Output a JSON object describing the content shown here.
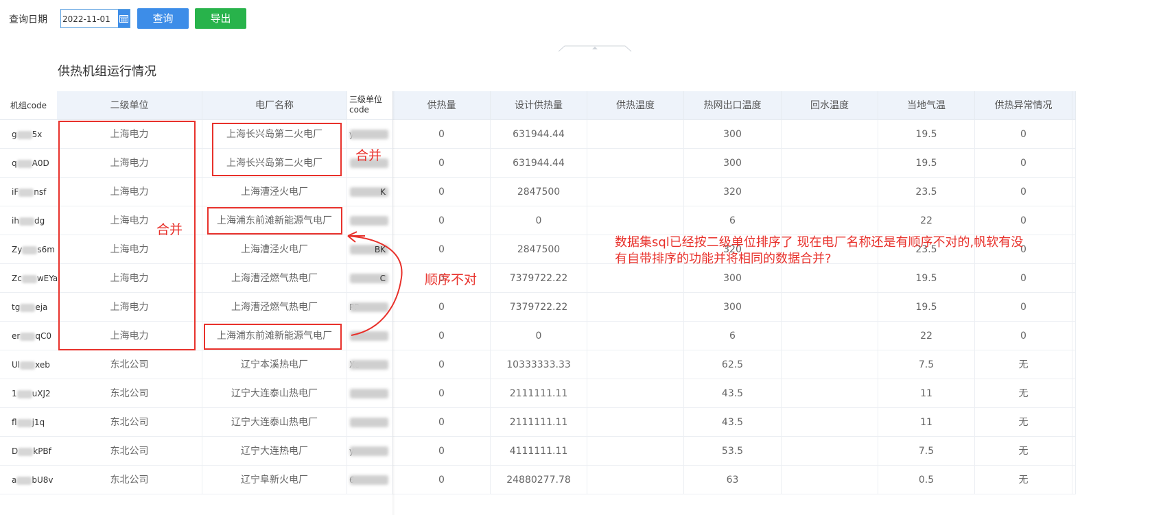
{
  "toolbar": {
    "date_label": "查询日期",
    "date_value": "2022-11-01",
    "query_button": "查询",
    "export_button": "导出",
    "calendar_icon": "calendar-icon",
    "query_color": "#3d8de8",
    "export_color": "#28b34b"
  },
  "page_title": "供热机组运行情况",
  "table": {
    "headers": [
      "机组code",
      "二级单位",
      "电厂名称",
      "三级单位code",
      "供热量",
      "设计供热量",
      "供热温度",
      "热网出口温度",
      "回水温度",
      "当地气温",
      "供热异常情况"
    ],
    "rows": [
      {
        "code_start": "g",
        "code_end": "5x",
        "unit": "上海电力",
        "plant": "上海长兴岛第二火电厂",
        "code3_start": "y",
        "code3_end": "",
        "heat": "0",
        "design_heat": "631944.44",
        "supply_temp": "",
        "outlet_temp": "300",
        "return_temp": "",
        "air_temp": "19.5",
        "anomaly": "0"
      },
      {
        "code_start": "q",
        "code_end": "A0D",
        "unit": "上海电力",
        "plant": "上海长兴岛第二火电厂",
        "code3_start": "",
        "code3_end": "",
        "heat": "0",
        "design_heat": "631944.44",
        "supply_temp": "",
        "outlet_temp": "300",
        "return_temp": "",
        "air_temp": "19.5",
        "anomaly": "0"
      },
      {
        "code_start": "iF",
        "code_end": "nsf",
        "unit": "上海电力",
        "plant": "上海漕泾火电厂",
        "code3_start": "",
        "code3_end": "K",
        "heat": "0",
        "design_heat": "2847500",
        "supply_temp": "",
        "outlet_temp": "320",
        "return_temp": "",
        "air_temp": "23.5",
        "anomaly": "0"
      },
      {
        "code_start": "ih",
        "code_end": "dg",
        "unit": "上海电力",
        "plant": "上海浦东前滩新能源气电厂",
        "code3_start": "",
        "code3_end": "",
        "heat": "0",
        "design_heat": "0",
        "supply_temp": "",
        "outlet_temp": "6",
        "return_temp": "",
        "air_temp": "22",
        "anomaly": "0"
      },
      {
        "code_start": "Zy",
        "code_end": "s6m",
        "unit": "上海电力",
        "plant": "上海漕泾火电厂",
        "code3_start": "",
        "code3_end": "BK",
        "heat": "0",
        "design_heat": "2847500",
        "supply_temp": "",
        "outlet_temp": "320",
        "return_temp": "",
        "air_temp": "23.5",
        "anomaly": "0"
      },
      {
        "code_start": "Zc",
        "code_end": "wEYa",
        "unit": "上海电力",
        "plant": "上海漕泾燃气热电厂",
        "code3_start": "",
        "code3_end": "C",
        "heat": "0",
        "design_heat": "7379722.22",
        "supply_temp": "",
        "outlet_temp": "300",
        "return_temp": "",
        "air_temp": "19.5",
        "anomaly": "0"
      },
      {
        "code_start": "tg",
        "code_end": "eja",
        "unit": "上海电力",
        "plant": "上海漕泾燃气热电厂",
        "code3_start": "PP",
        "code3_end": "",
        "heat": "0",
        "design_heat": "7379722.22",
        "supply_temp": "",
        "outlet_temp": "300",
        "return_temp": "",
        "air_temp": "19.5",
        "anomaly": "0"
      },
      {
        "code_start": "er",
        "code_end": "qC0",
        "unit": "上海电力",
        "plant": "上海浦东前滩新能源气电厂",
        "code3_start": "",
        "code3_end": "",
        "heat": "0",
        "design_heat": "0",
        "supply_temp": "",
        "outlet_temp": "6",
        "return_temp": "",
        "air_temp": "22",
        "anomaly": "0"
      },
      {
        "code_start": "Ul",
        "code_end": "xeb",
        "unit": "东北公司",
        "plant": "辽宁本溪热电厂",
        "code3_start": "Xe",
        "code3_end": "",
        "heat": "0",
        "design_heat": "10333333.33",
        "supply_temp": "",
        "outlet_temp": "62.5",
        "return_temp": "",
        "air_temp": "7.5",
        "anomaly": "无"
      },
      {
        "code_start": "1",
        "code_end": "uXJ2",
        "unit": "东北公司",
        "plant": "辽宁大连泰山热电厂",
        "code3_start": "",
        "code3_end": "",
        "heat": "0",
        "design_heat": "2111111.11",
        "supply_temp": "",
        "outlet_temp": "43.5",
        "return_temp": "",
        "air_temp": "11",
        "anomaly": "无"
      },
      {
        "code_start": "fl",
        "code_end": "j1q",
        "unit": "东北公司",
        "plant": "辽宁大连泰山热电厂",
        "code3_start": "",
        "code3_end": "",
        "heat": "0",
        "design_heat": "2111111.11",
        "supply_temp": "",
        "outlet_temp": "43.5",
        "return_temp": "",
        "air_temp": "11",
        "anomaly": "无"
      },
      {
        "code_start": "D",
        "code_end": "kPBf",
        "unit": "东北公司",
        "plant": "辽宁大连热电厂",
        "code3_start": "y",
        "code3_end": "",
        "heat": "0",
        "design_heat": "4111111.11",
        "supply_temp": "",
        "outlet_temp": "53.5",
        "return_temp": "",
        "air_temp": "7.5",
        "anomaly": "无"
      },
      {
        "code_start": "a",
        "code_end": "bU8v",
        "unit": "东北公司",
        "plant": "辽宁阜新火电厂",
        "code3_start": "6",
        "code3_end": "",
        "heat": "0",
        "design_heat": "24880277.78",
        "supply_temp": "",
        "outlet_temp": "63",
        "return_temp": "",
        "air_temp": "0.5",
        "anomaly": "无"
      }
    ]
  },
  "annotations": {
    "merge_label_1": "合并",
    "merge_label_2": "合并",
    "order_wrong": "顺序不对",
    "comment_line1": "数据集sql已经按二级单位排序了  现在电厂名称还是有顺序不对的,帆软有没",
    "comment_line2": "有自带排序的功能并将相同的数据合并?",
    "color": "#e8312b"
  }
}
